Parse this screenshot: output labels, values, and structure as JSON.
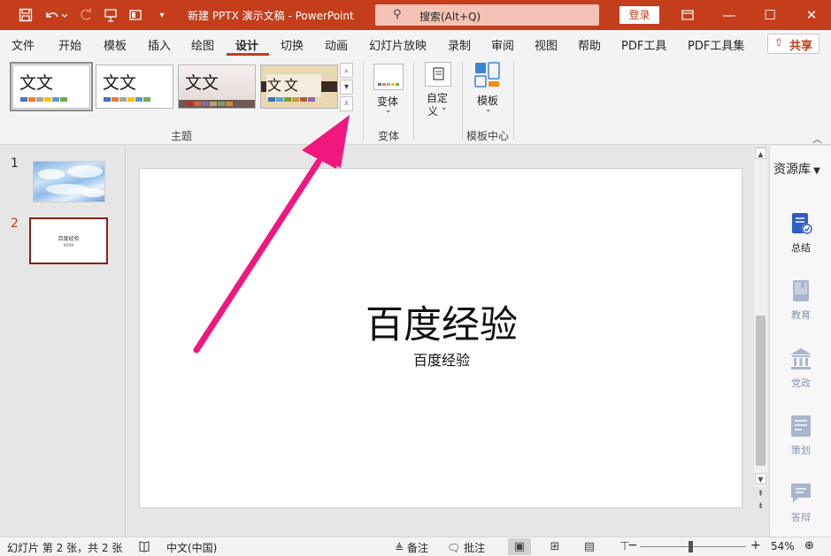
{
  "titlebar": {
    "title": "新建 PPTX 演示文稿 - PowerPoint",
    "search_placeholder": "搜索(Alt+Q)",
    "login_label": "登录"
  },
  "menu": {
    "items": [
      "文件",
      "开始",
      "模板",
      "插入",
      "绘图",
      "设计",
      "切换",
      "动画",
      "幻灯片放映",
      "录制",
      "审阅",
      "视图",
      "帮助",
      "PDF工具",
      "PDF工具集"
    ],
    "active": "设计",
    "share_label": "共享"
  },
  "ribbon": {
    "themes": [
      {
        "label": "文文",
        "swatches": [
          "#4472c4",
          "#ed7d31",
          "#a5a5a5",
          "#ffc000",
          "#5b9bd5",
          "#70ad47"
        ]
      },
      {
        "label": "文文",
        "swatches": [
          "#4472c4",
          "#ed7d31",
          "#a5a5a5",
          "#ffc000",
          "#5b9bd5",
          "#70ad47"
        ]
      },
      {
        "label": "文文",
        "swatches": [
          "#b5322e",
          "#d2603c",
          "#7f6f9b",
          "#b6a37a",
          "#7a9e6a",
          "#c48a4a"
        ]
      },
      {
        "label": "文文",
        "swatches": [
          "#3f6bb0",
          "#5aa2d2",
          "#7e9b3f",
          "#c49d3c",
          "#b05a3a",
          "#8a6aa8"
        ]
      }
    ],
    "group_themes_label": "主题",
    "variant_label": "变体",
    "group_variant_label": "变体",
    "custom_label_1": "自定",
    "custom_label_2": "义",
    "template_label": "模板",
    "group_template_label": "模板中心"
  },
  "slides": {
    "numbers": [
      "1",
      "2"
    ],
    "thumb2_title": "百度经验",
    "thumb2_sub": "百度经验"
  },
  "slide": {
    "title": "百度经验",
    "subtitle": "百度经验"
  },
  "rightpanel": {
    "title": "资源库",
    "items": [
      {
        "label": "总结",
        "color": "#2f5ec4"
      },
      {
        "label": "教育",
        "color": "#9aa6c4"
      },
      {
        "label": "党政",
        "color": "#9aa6c4"
      },
      {
        "label": "策划",
        "color": "#9aa6c4"
      },
      {
        "label": "答辩",
        "color": "#9aa6c4"
      }
    ]
  },
  "statusbar": {
    "slide_info": "幻灯片 第 2 张，共 2 张",
    "language": "中文(中国)",
    "notes_label": "备注",
    "comments_label": "批注",
    "zoom": "54%"
  },
  "colors": {
    "accent": "#c43e1c",
    "arrow": "#f0177f"
  }
}
